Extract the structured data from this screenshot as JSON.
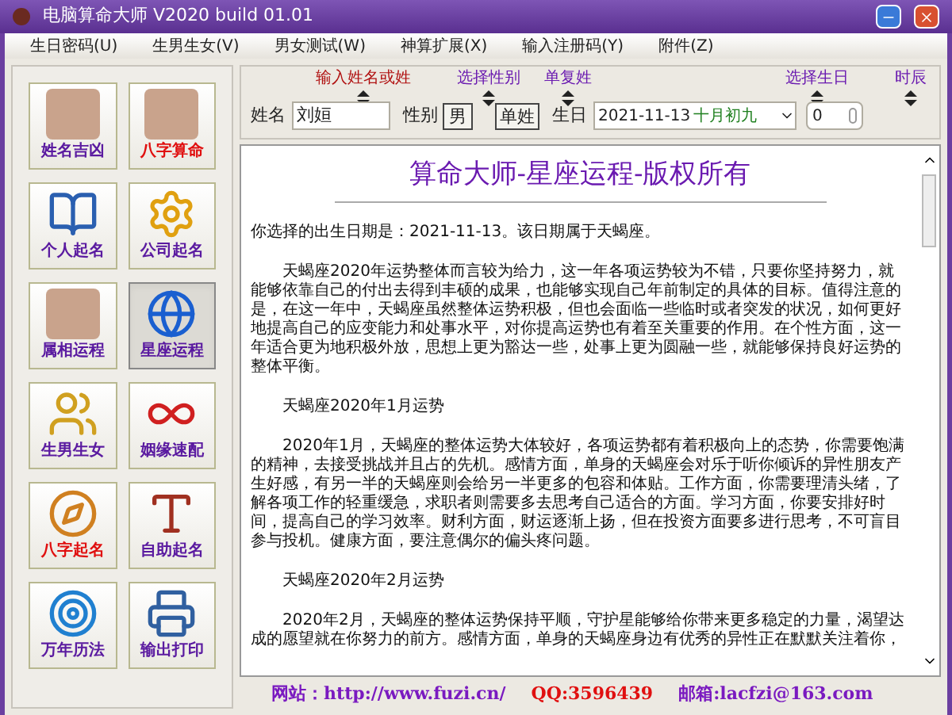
{
  "window": {
    "title": "电脑算命大师  V2020 build 01.01"
  },
  "menu": [
    {
      "label": "生日密码(U)"
    },
    {
      "label": "生男生女(V)"
    },
    {
      "label": "男女测试(W)"
    },
    {
      "label": "神算扩展(X)"
    },
    {
      "label": "输入注册码(Y)"
    },
    {
      "label": "附件(Z)"
    }
  ],
  "tools": [
    {
      "label": "姓名吉凶",
      "color": "#5a1aa0",
      "kind": "photo",
      "selected": false
    },
    {
      "label": "八字算命",
      "color": "#e01010",
      "kind": "photo",
      "selected": false
    },
    {
      "label": "个人起名",
      "color": "#5a1aa0",
      "kind": "book",
      "selected": false
    },
    {
      "label": "公司起名",
      "color": "#5a1aa0",
      "kind": "gear",
      "selected": false
    },
    {
      "label": "属相运程",
      "color": "#5a1aa0",
      "kind": "photo",
      "selected": false
    },
    {
      "label": "星座运程",
      "color": "#5a1aa0",
      "kind": "globe",
      "selected": true
    },
    {
      "label": "生男生女",
      "color": "#5a1aa0",
      "kind": "people",
      "selected": false
    },
    {
      "label": "姻缘速配",
      "color": "#5a1aa0",
      "kind": "knot",
      "selected": false
    },
    {
      "label": "八字起名",
      "color": "#e01010",
      "kind": "compass",
      "selected": false
    },
    {
      "label": "自助起名",
      "color": "#5a1aa0",
      "kind": "letters",
      "selected": false
    },
    {
      "label": "万年历法",
      "color": "#5a1aa0",
      "kind": "target",
      "selected": false
    },
    {
      "label": "输出打印",
      "color": "#5a1aa0",
      "kind": "printer",
      "selected": false
    }
  ],
  "form": {
    "hints": [
      {
        "text": "输入姓名或姓",
        "color": "#b01010"
      },
      {
        "text": "选择性别",
        "color": "#6a1ab0"
      },
      {
        "text": "单复姓",
        "color": "#6a1ab0"
      },
      {
        "text": "选择生日",
        "color": "#6a1ab0"
      },
      {
        "text": "时辰",
        "color": "#6a1ab0"
      }
    ],
    "name_label": "姓名",
    "name_value": "刘姮",
    "gender_label": "性别",
    "gender": "男",
    "surname_type": "单姓",
    "birthday_label": "生日",
    "birthday": "2021-11-13",
    "lunar": "十月初九",
    "hour": "0"
  },
  "content": {
    "title": "算命大师-星座运程-版权所有",
    "paragraphs": [
      {
        "kind": "plain",
        "text": "你选择的出生日期是：2021-11-13。该日期属于天蝎座。"
      },
      {
        "kind": "indent",
        "text": "天蝎座2020年运势整体而言较为给力，这一年各项运势较为不错，只要你坚持努力，就能够依靠自己的付出去得到丰硕的成果，也能够实现自己年前制定的具体的目标。值得注意的是，在这一年中，天蝎座虽然整体运势积极，但也会面临一些临时或者突发的状况，如何更好地提高自己的应变能力和处事水平，对你提高运势也有着至关重要的作用。在个性方面，这一年适合更为地积极外放，思想上更为豁达一些，处事上更为圆融一些，就能够保持良好运势的整体平衡。"
      },
      {
        "kind": "indent",
        "text": "天蝎座2020年1月运势"
      },
      {
        "kind": "indent",
        "text": "2020年1月，天蝎座的整体运势大体较好，各项运势都有着积极向上的态势，你需要饱满的精神，去接受挑战并且占的先机。感情方面，单身的天蝎座会对乐于听你倾诉的异性朋友产生好感，有另一半的天蝎座则会给另一半更多的包容和体贴。工作方面，你需要理清头绪，了解各项工作的轻重缓急，求职者则需要多去思考自己适合的方面。学习方面，你要安排好时间，提高自己的学习效率。财利方面，财运逐渐上扬，但在投资方面要多进行思考，不可盲目参与投机。健康方面，要注意偶尔的偏头疼问题。"
      },
      {
        "kind": "indent",
        "text": "天蝎座2020年2月运势"
      },
      {
        "kind": "indent",
        "text": "2020年2月，天蝎座的整体运势保持平顺，守护星能够给你带来更多稳定的力量，渴望达成的愿望就在你努力的前方。感情方面，单身的天蝎座身边有优秀的异性正在默默关注着你，"
      }
    ]
  },
  "footer": [
    {
      "text": "网站：http://www.fuzi.cn/",
      "color": "#7a1ac0"
    },
    {
      "text": "QQ:3596439",
      "color": "#e01010"
    },
    {
      "text": "邮箱:lacfzi@163.com",
      "color": "#7a1ac0"
    }
  ]
}
